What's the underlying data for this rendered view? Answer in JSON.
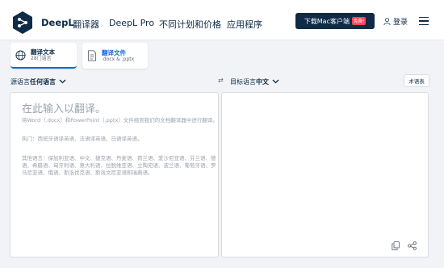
{
  "header": {
    "brand": "DeepL",
    "brand_sub": "翻译器",
    "nav": [
      "DeepL Pro",
      "不同计划和价格",
      "应用程序"
    ],
    "download_label": "下载Mac客户端",
    "download_badge": "免费!",
    "login_label": "登录"
  },
  "tabs": [
    {
      "title": "翻译文本",
      "subtitle": "28门语言",
      "icon": "globe-icon"
    },
    {
      "title": "翻译文件",
      "subtitle": ".docx & .pptx",
      "icon": "file-icon"
    }
  ],
  "source_lang": {
    "prefix": "源语言",
    "value": "任何语言"
  },
  "target_lang": {
    "prefix": "目标语言",
    "value": "中文"
  },
  "glossary_label": "术语表",
  "source_panel": {
    "placeholder": "在此输入以翻译。",
    "hint_drag": "将Word（.docx）和PowerPoint（.pptx）文件拖到我们的文档翻译器中进行翻译。",
    "hint_popular": "热门：西班牙语译英语、法语译英语、日语译英语。",
    "hint_other": "其他语言：保加利亚语、中文、捷克语、丹麦语、荷兰语、爱沙尼亚语、芬兰语、德语、希腊语、匈牙利语、意大利语、拉脱维亚语、立陶宛语、波兰语、葡萄牙语、罗马尼亚语、俄语、斯洛伐克语、斯洛文尼亚语和瑞典语。"
  },
  "colors": {
    "brand": "#0f2b46",
    "accent": "#0f6ad6",
    "background": "#f1f3f6"
  }
}
